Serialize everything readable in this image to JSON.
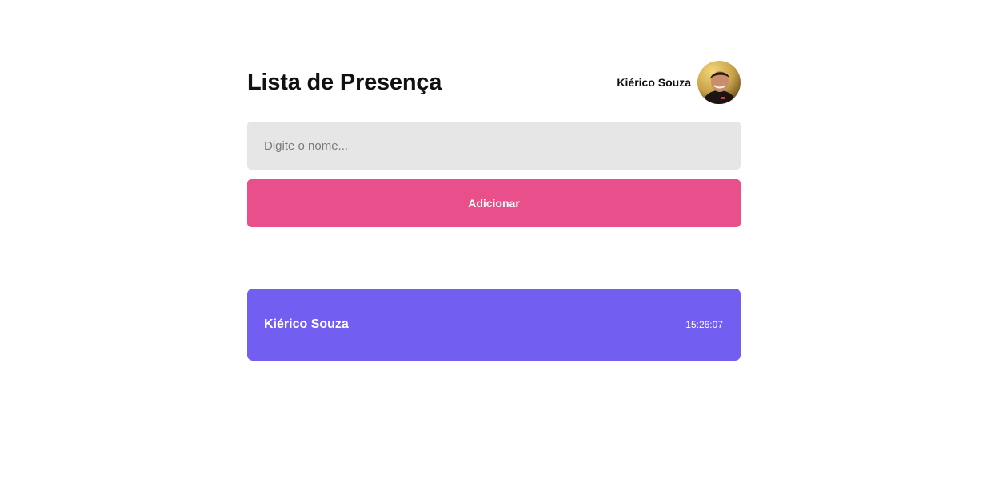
{
  "header": {
    "title": "Lista de Presença",
    "user_name": "Kiérico Souza"
  },
  "form": {
    "input_placeholder": "Digite o nome...",
    "input_value": "",
    "add_button_label": "Adicionar"
  },
  "attendance": [
    {
      "name": "Kiérico Souza",
      "time": "15:26:07"
    }
  ],
  "colors": {
    "accent_button": "#e94f8a",
    "card_background": "#735ef2",
    "input_background": "#e6e6e6"
  }
}
